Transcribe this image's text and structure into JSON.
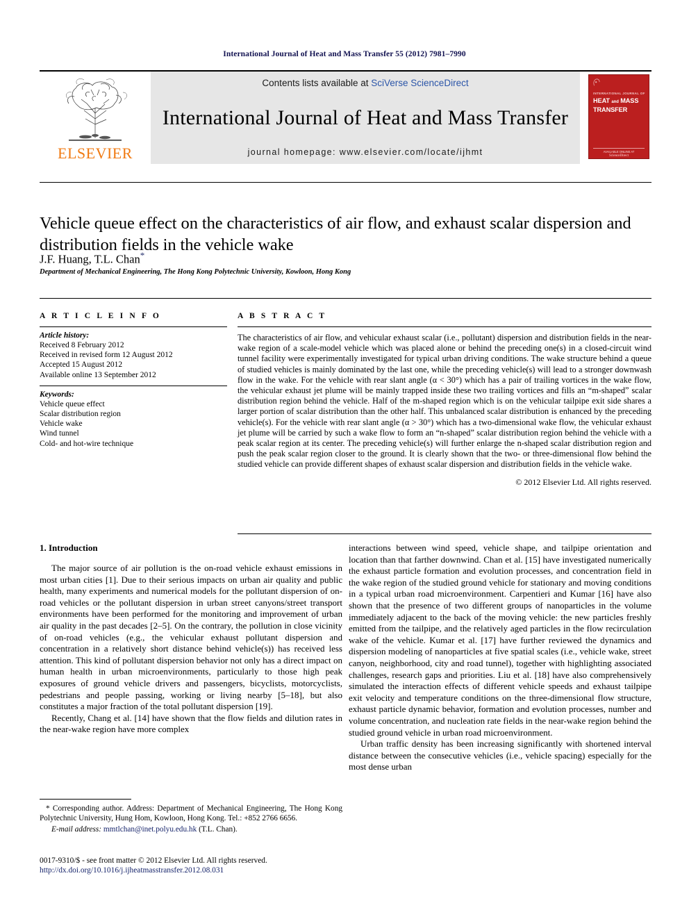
{
  "running_head": "International Journal of Heat and Mass Transfer 55 (2012) 7981–7990",
  "masthead": {
    "publisher_name": "ELSEVIER",
    "contents_prefix": "Contents lists available at ",
    "sciencedirect_link": "SciVerse ScienceDirect",
    "journal_title": "International Journal of Heat and Mass Transfer",
    "homepage_line": "journal homepage: www.elsevier.com/locate/ijhmt",
    "cover": {
      "eyebrow": "INTERNATIONAL JOURNAL OF",
      "line1": "HEAT",
      "line_and": "and",
      "line2": "MASS",
      "line3": "TRANSFER",
      "footer": "AVAILABLE ONLINE AT",
      "footer2": "ScienceDirect"
    },
    "accent_color": "#bb1f1f",
    "link_color": "#2b55a8",
    "band_color": "#e6e6e6",
    "elsevier_orange": "#f07a12"
  },
  "article": {
    "title": "Vehicle queue effect on the characteristics of air flow, and exhaust scalar dispersion and distribution fields in the vehicle wake",
    "authors": "J.F. Huang, T.L. Chan",
    "corresponding_marker": "*",
    "affiliation": "Department of Mechanical Engineering, The Hong Kong Polytechnic University, Kowloon, Hong Kong"
  },
  "article_info": {
    "heading": "A R T I C L E  I N F O",
    "history_label": "Article history:",
    "history": [
      "Received 8 February 2012",
      "Received in revised form 12 August 2012",
      "Accepted 15 August 2012",
      "Available online 13 September 2012"
    ],
    "keywords_label": "Keywords:",
    "keywords": [
      "Vehicle queue effect",
      "Scalar distribution region",
      "Vehicle wake",
      "Wind tunnel",
      "Cold- and hot-wire technique"
    ]
  },
  "abstract": {
    "heading": "A B S T R A C T",
    "body": "The characteristics of air flow, and vehicular exhaust scalar (i.e., pollutant) dispersion and distribution fields in the near-wake region of a scale-model vehicle which was placed alone or behind the preceding one(s) in a closed-circuit wind tunnel facility were experimentally investigated for typical urban driving conditions. The wake structure behind a queue of studied vehicles is mainly dominated by the last one, while the preceding vehicle(s) will lead to a stronger downwash flow in the wake. For the vehicle with rear slant angle (α < 30°) which has a pair of trailing vortices in the wake flow, the vehicular exhaust jet plume will be mainly trapped inside these two trailing vortices and fills an “m-shaped” scalar distribution region behind the vehicle. Half of the m-shaped region which is on the vehicular tailpipe exit side shares a larger portion of scalar distribution than the other half. This unbalanced scalar distribution is enhanced by the preceding vehicle(s). For the vehicle with rear slant angle (α > 30°) which has a two-dimensional wake flow, the vehicular exhaust jet plume will be carried by such a wake flow to form an “n-shaped” scalar distribution region behind the vehicle with a peak scalar region at its center. The preceding vehicle(s) will further enlarge the n-shaped scalar distribution region and push the peak scalar region closer to the ground. It is clearly shown that the two- or three-dimensional flow behind the studied vehicle can provide different shapes of exhaust scalar dispersion and distribution fields in the vehicle wake.",
    "copyright": "© 2012 Elsevier Ltd. All rights reserved."
  },
  "introduction": {
    "heading": "1. Introduction",
    "left_paragraphs": [
      "The major source of air pollution is the on-road vehicle exhaust emissions in most urban cities [1]. Due to their serious impacts on urban air quality and public health, many experiments and numerical models for the pollutant dispersion of on-road vehicles or the pollutant dispersion in urban street canyons/street transport environments have been performed for the monitoring and improvement of urban air quality in the past decades [2–5]. On the contrary, the pollution in close vicinity of on-road vehicles (e.g., the vehicular exhaust pollutant dispersion and concentration in a relatively short distance behind vehicle(s)) has received less attention. This kind of pollutant dispersion behavior not only has a direct impact on human health in urban microenvironments, particularly to those high peak exposures of ground vehicle drivers and passengers, bicyclists, motorcyclists, pedestrians and people passing, working or living nearby [5–18], but also constitutes a major fraction of the total pollutant dispersion [19].",
      "Recently, Chang et al. [14] have shown that the flow fields and dilution rates in the near-wake region have more complex"
    ],
    "right_paragraphs": [
      "interactions between wind speed, vehicle shape, and tailpipe orientation and location than that farther downwind. Chan et al. [15] have investigated numerically the exhaust particle formation and evolution processes, and concentration field in the wake region of the studied ground vehicle for stationary and moving conditions in a typical urban road microenvironment. Carpentieri and Kumar [16] have also shown that the presence of two different groups of nanoparticles in the volume immediately adjacent to the back of the moving vehicle: the new particles freshly emitted from the tailpipe, and the relatively aged particles in the flow recirculation wake of the vehicle. Kumar et al. [17] have further reviewed the dynamics and dispersion modeling of nanoparticles at five spatial scales (i.e., vehicle wake, street canyon, neighborhood, city and road tunnel), together with highlighting associated challenges, research gaps and priorities. Liu et al. [18] have also comprehensively simulated the interaction effects of different vehicle speeds and exhaust tailpipe exit velocity and temperature conditions on the three-dimensional flow structure, exhaust particle dynamic behavior, formation and evolution processes, number and volume concentration, and nucleation rate fields in the near-wake region behind the studied ground vehicle in urban road microenvironment.",
      "Urban traffic density has been increasing significantly with shortened interval distance between the consecutive vehicles (i.e., vehicle spacing) especially for the most dense urban"
    ]
  },
  "footnotes": {
    "corresponding": "* Corresponding author. Address: Department of Mechanical Engineering, The Hong Kong Polytechnic University, Hung Hom, Kowloon, Hong Kong. Tel.: +852 2766 6656.",
    "email_label": "E-mail address:",
    "email": "mmtlchan@inet.polyu.edu.hk",
    "email_suffix": "(T.L. Chan).",
    "issn_line": "0017-9310/$ - see front matter © 2012 Elsevier Ltd. All rights reserved.",
    "doi": "http://dx.doi.org/10.1016/j.ijheatmasstransfer.2012.08.031"
  }
}
